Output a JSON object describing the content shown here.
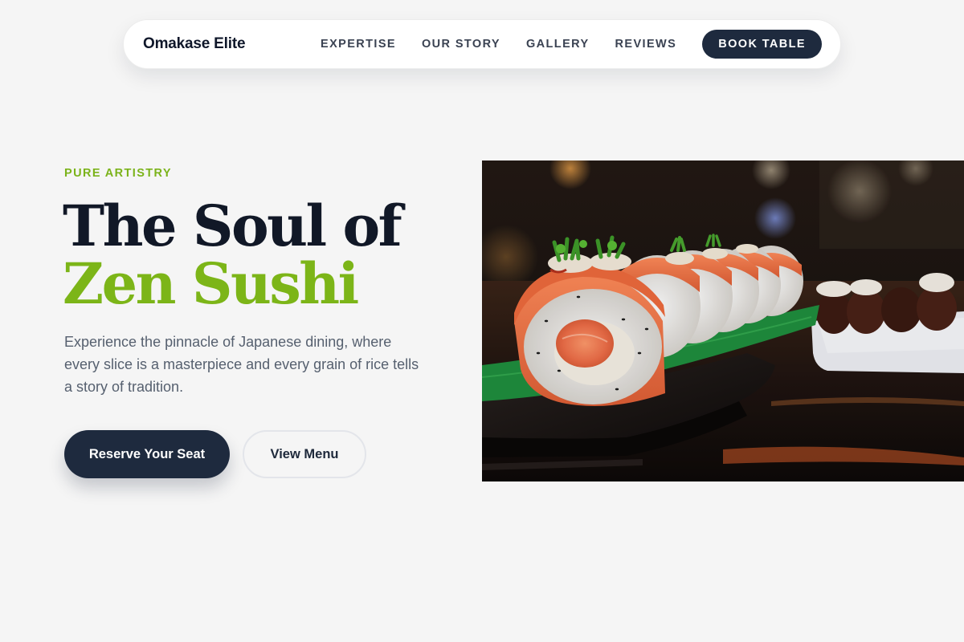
{
  "nav": {
    "brand": "Omakase Elite",
    "links": [
      {
        "label": "EXPERTISE"
      },
      {
        "label": "OUR STORY"
      },
      {
        "label": "GALLERY"
      },
      {
        "label": "REVIEWS"
      }
    ],
    "cta": "BOOK TABLE"
  },
  "hero": {
    "eyebrow": "PURE ARTISTRY",
    "title_line1": "The Soul of",
    "title_line2": "Zen Sushi",
    "description": "Experience the pinnacle of Japanese dining, where every slice is a masterpiece and every grain of rice tells a story of tradition.",
    "primary_button": "Reserve Your Seat",
    "secondary_button": "View Menu",
    "image_subject": "salmon-sushi-roll-photo"
  },
  "colors": {
    "background": "#f5f5f5",
    "navy": "#1e2a3e",
    "accent_green": "#7cb518",
    "headline_dark": "#111827",
    "body_gray": "#56606f"
  }
}
